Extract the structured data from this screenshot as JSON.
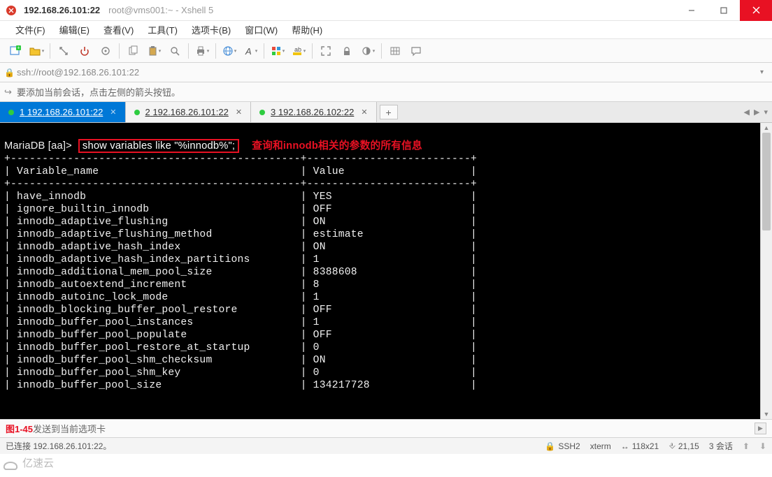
{
  "titlebar": {
    "main": "192.168.26.101:22",
    "sub": "root@vms001:~ - Xshell 5"
  },
  "menu": [
    "文件(F)",
    "编辑(E)",
    "查看(V)",
    "工具(T)",
    "选项卡(B)",
    "窗口(W)",
    "帮助(H)"
  ],
  "toolbar_icons": [
    "new-session-icon",
    "open-icon",
    "save-icon",
    "sep",
    "reconnect-icon",
    "disconnect-icon",
    "properties-icon",
    "sep",
    "copy-icon",
    "paste-icon",
    "find-icon",
    "sep",
    "print-icon",
    "sep",
    "font-icon",
    "globe-icon",
    "encoding-icon",
    "sep",
    "color-icon",
    "highlight-icon",
    "sep",
    "fullscreen-icon",
    "transparency-icon",
    "lock-icon",
    "sep",
    "keypad-icon",
    "chat-icon"
  ],
  "addressbar": {
    "url": "ssh://root@192.168.26.101:22"
  },
  "hintbar": {
    "text": "要添加当前会话，点击左侧的箭头按钮。"
  },
  "tabs": [
    {
      "index": "1",
      "label": "192.168.26.101:22",
      "active": true
    },
    {
      "index": "2",
      "label": "192.168.26.101:22",
      "active": false
    },
    {
      "index": "3",
      "label": "192.168.26.102:22",
      "active": false
    }
  ],
  "terminal": {
    "prompt": "MariaDB [aa]>",
    "command": "show variables like \"%innodb%\";",
    "annotation": "查询和innodb相关的参数的所有信息",
    "columns": [
      "Variable_name",
      "Value"
    ],
    "rows": [
      [
        "have_innodb",
        "YES"
      ],
      [
        "ignore_builtin_innodb",
        "OFF"
      ],
      [
        "innodb_adaptive_flushing",
        "ON"
      ],
      [
        "innodb_adaptive_flushing_method",
        "estimate"
      ],
      [
        "innodb_adaptive_hash_index",
        "ON"
      ],
      [
        "innodb_adaptive_hash_index_partitions",
        "1"
      ],
      [
        "innodb_additional_mem_pool_size",
        "8388608"
      ],
      [
        "innodb_autoextend_increment",
        "8"
      ],
      [
        "innodb_autoinc_lock_mode",
        "1"
      ],
      [
        "innodb_blocking_buffer_pool_restore",
        "OFF"
      ],
      [
        "innodb_buffer_pool_instances",
        "1"
      ],
      [
        "innodb_buffer_pool_populate",
        "OFF"
      ],
      [
        "innodb_buffer_pool_restore_at_startup",
        "0"
      ],
      [
        "innodb_buffer_pool_shm_checksum",
        "ON"
      ],
      [
        "innodb_buffer_pool_shm_key",
        "0"
      ],
      [
        "innodb_buffer_pool_size",
        "134217728"
      ]
    ]
  },
  "bottom_msg": {
    "fig": "图1-45",
    "text": "发送到当前选项卡"
  },
  "statusbar": {
    "left": "已连接 192.168.26.101:22。",
    "ssh": "SSH2",
    "term": "xterm",
    "size": "118x21",
    "pos": "21,15",
    "sessions": "3 会话",
    "watermark": "亿速云"
  }
}
